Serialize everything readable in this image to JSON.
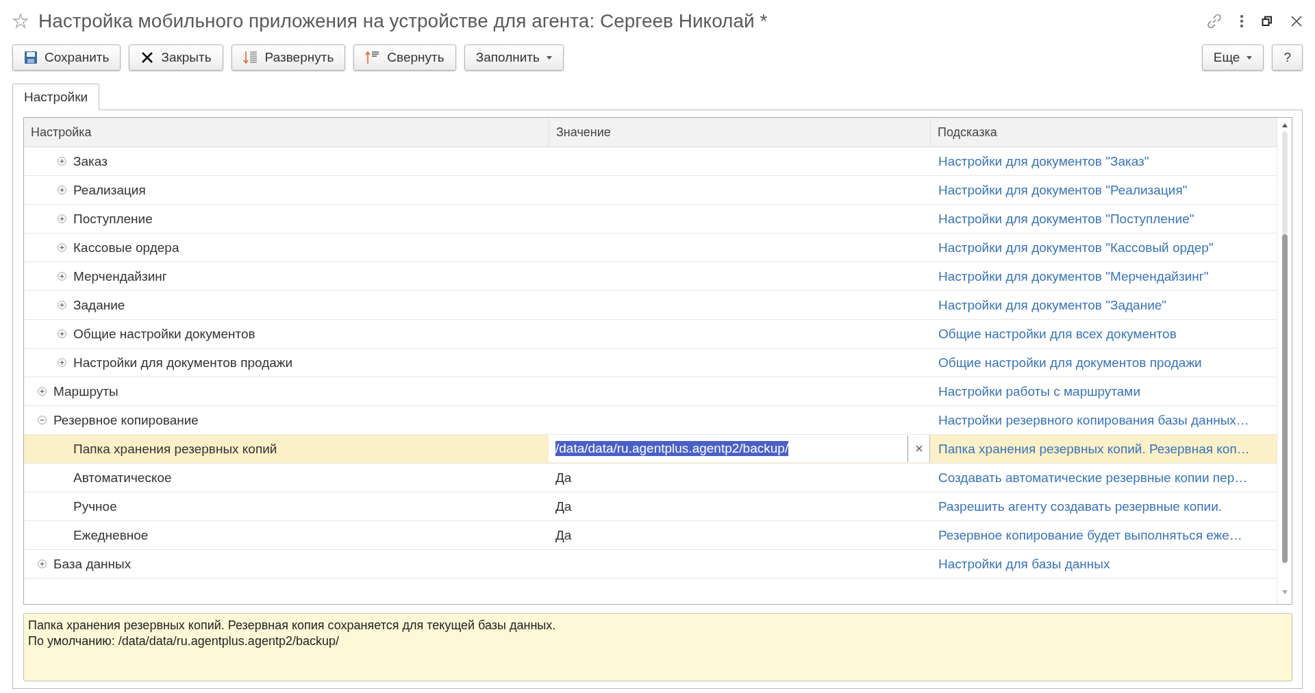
{
  "window": {
    "title": "Настройка мобильного приложения на устройстве для агента: Сергеев Николай *",
    "favorite": false
  },
  "toolbar": {
    "buttons": [
      {
        "kind": "save",
        "label": "Сохранить"
      },
      {
        "kind": "close",
        "label": "Закрыть"
      },
      {
        "kind": "expand",
        "label": "Развернуть"
      },
      {
        "kind": "collapse",
        "label": "Свернуть"
      },
      {
        "kind": "dropdown",
        "label": "Заполнить"
      }
    ],
    "right_buttons": [
      {
        "kind": "dropdown",
        "label": "Еще"
      },
      {
        "kind": "plain",
        "label": "?"
      }
    ]
  },
  "tabs": [
    {
      "label": "Настройки",
      "selected": true
    }
  ],
  "table": {
    "columns": [
      "Настройка",
      "Значение",
      "Подсказка"
    ],
    "continued_children": [
      {
        "name": "Заказ",
        "hint": "Настройки для документов \"Заказ\"",
        "expanded": false,
        "selected": false
      },
      {
        "name": "Реализация",
        "hint": "Настройки для документов \"Реализация\"",
        "expanded": false,
        "selected": false
      },
      {
        "name": "Поступление",
        "hint": "Настройки для документов \"Поступление\"",
        "expanded": false,
        "selected": false
      },
      {
        "name": "Кассовые ордера",
        "hint": "Настройки для документов \"Кассовый ордер\"",
        "expanded": false,
        "selected": false
      },
      {
        "name": "Мерчендайзинг",
        "hint": "Настройки для документов \"Мерчендайзинг\"",
        "expanded": false,
        "selected": false
      },
      {
        "name": "Задание",
        "hint": "Настройки для документов \"Задание\"",
        "expanded": false,
        "selected": false
      },
      {
        "name": "Общие настройки документов",
        "hint": "Общие настройки для всех документов",
        "expanded": false,
        "selected": false
      },
      {
        "name": "Настройки для документов продажи",
        "hint": "Общие настройки для документов продажи",
        "expanded": false,
        "selected": false
      }
    ],
    "rows": [
      {
        "name": "Маршруты",
        "hint": "Настройки работы с маршрутами",
        "expanded": false,
        "selected": false
      },
      {
        "name": "Резервное копирование",
        "hint": "Настройки резервного копирования базы данных…",
        "expanded": true,
        "selected": false,
        "children": [
          {
            "name": "Папка хранения резервных копий",
            "value": "/data/data/ru.agentplus.agentp2/backup/",
            "hint": "Папка хранения резервных копий. Резервная коп…",
            "selected": true
          },
          {
            "name": "Автоматическое",
            "value": "Да",
            "hint": "Создавать автоматические резервные копии пер…",
            "selected": false
          },
          {
            "name": "Ручное",
            "value": "Да",
            "hint": "Разрешить агенту создавать резервные копии.",
            "selected": false
          },
          {
            "name": "Ежедневное",
            "value": "Да",
            "hint": "Резервное копирование будет выполняться еже…",
            "selected": false
          }
        ]
      },
      {
        "name": "База данных",
        "hint": "Настройки для базы данных",
        "expanded": false,
        "selected": false
      }
    ]
  },
  "description": [
    "Папка хранения резервных копий. Резервная копия сохраняется для текущей базы данных.",
    "По умолчанию: /data/data/ru.agentplus.agentp2/backup/"
  ]
}
